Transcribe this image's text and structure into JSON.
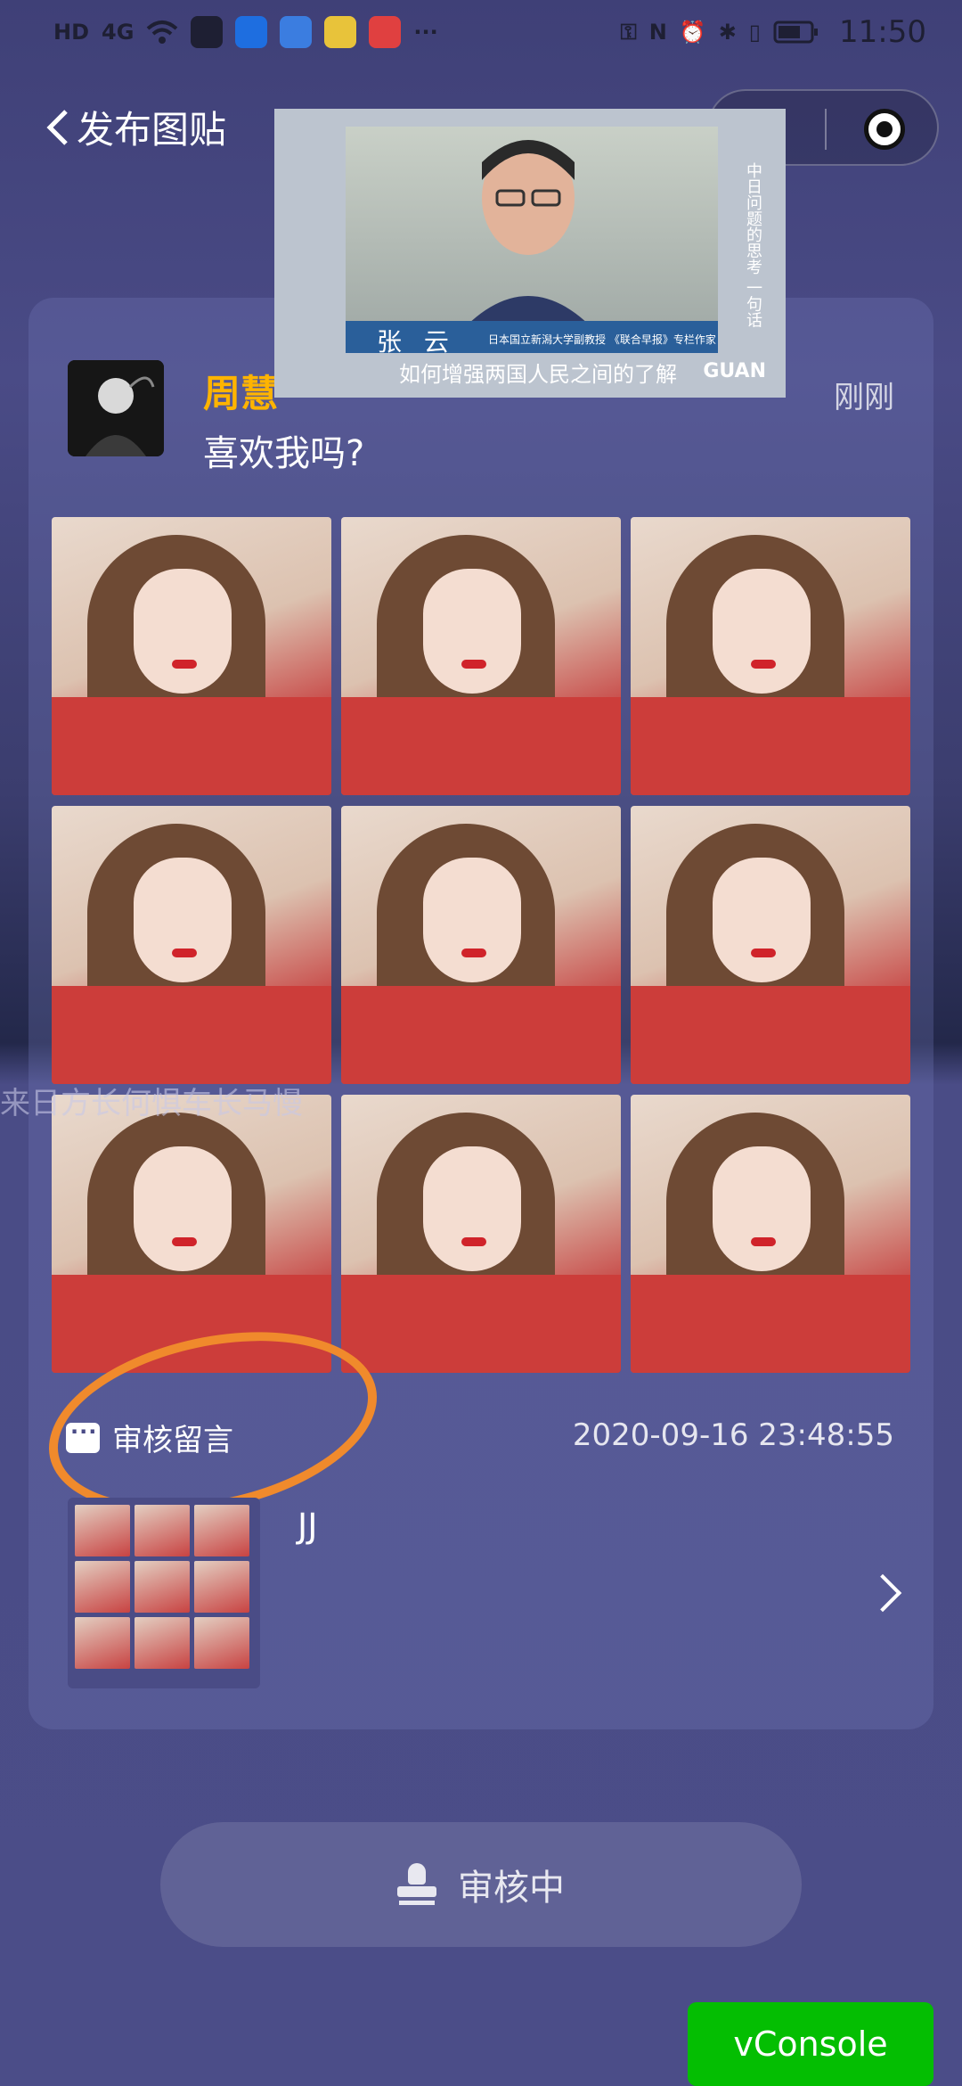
{
  "status_bar": {
    "left_labels": [
      "HD",
      "4G"
    ],
    "time": "11:50"
  },
  "nav": {
    "title": "发布图贴"
  },
  "video_overlay": {
    "name": "张  云",
    "description": "日本国立新潟大学副教授 《联合早报》专栏作家",
    "subtitle": "如何增强两国人民之间的了解",
    "logo": "GUAN",
    "vertical_text": "中日问题的思考 一句话"
  },
  "post": {
    "username": "周慧",
    "text": "喜欢我吗?",
    "time": "刚刚",
    "photo_count": 9
  },
  "faint_overlay_text": "来日方长何惧车长马慢",
  "comment": {
    "label": "审核留言",
    "timestamp": "2020-09-16 23:48:55",
    "author": "JJ"
  },
  "review_button": {
    "label": "审核中"
  },
  "vconsole": {
    "label": "vConsole"
  },
  "colors": {
    "accent_username": "#ffb400",
    "annotation_circle": "#f08a2c",
    "vconsole_green": "#04be02"
  }
}
